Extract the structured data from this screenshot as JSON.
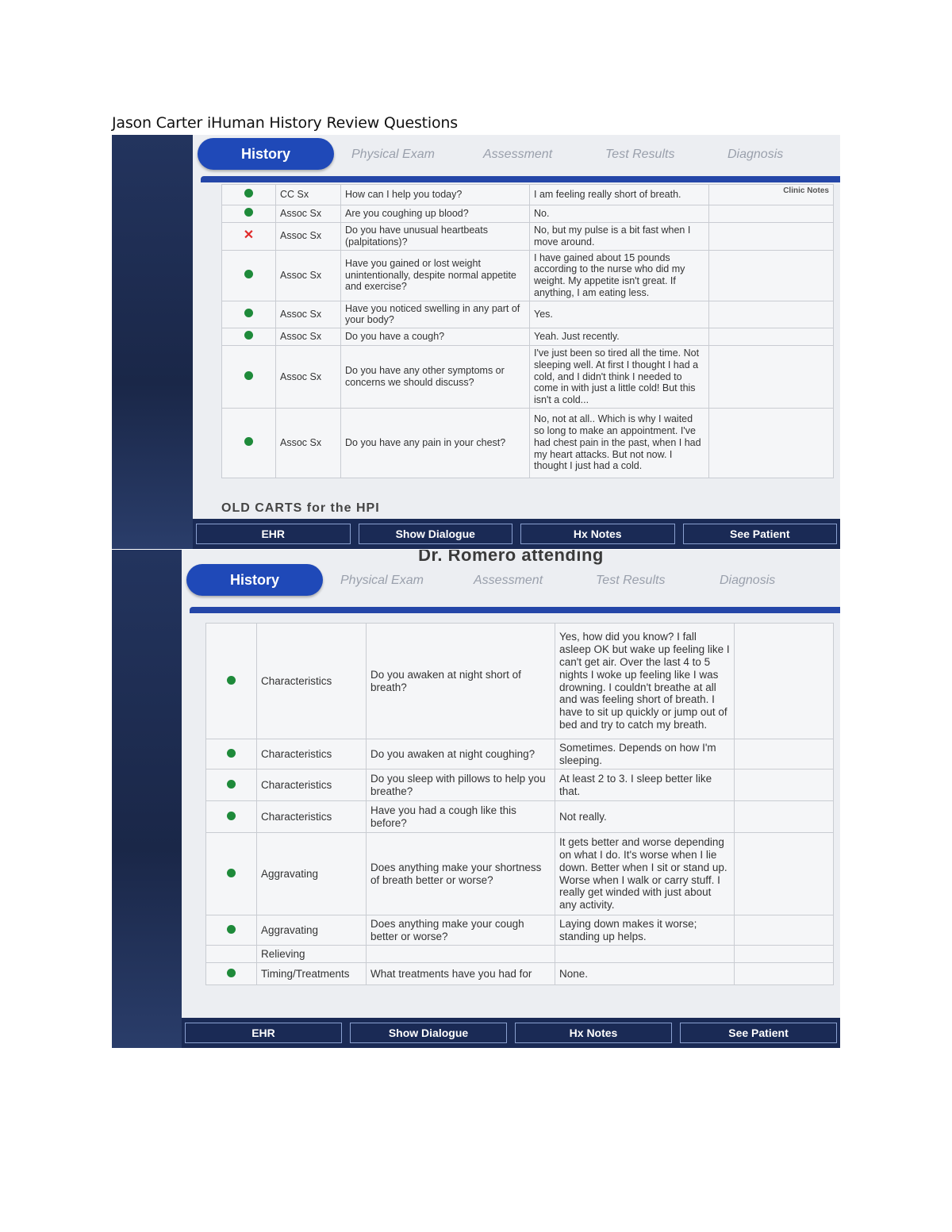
{
  "document_title": "Jason Carter iHuman History Review Questions",
  "top": {
    "tabs": {
      "active": "History",
      "others": [
        "Physical Exam",
        "Assessment",
        "Test Results",
        "Diagnosis"
      ]
    },
    "notes_header": "Clinic Notes",
    "rows": [
      {
        "status": "green",
        "category": "CC Sx",
        "question": "How can I help you today?",
        "answer": "I am feeling really short of breath."
      },
      {
        "status": "green",
        "category": "Assoc Sx",
        "question": "Are you coughing up blood?",
        "answer": "No."
      },
      {
        "status": "red-x",
        "category": "Assoc Sx",
        "question": "Do you have unusual heartbeats (palpitations)?",
        "answer": "No, but my pulse is a bit fast when I move around."
      },
      {
        "status": "green",
        "category": "Assoc Sx",
        "question": "Have you gained or lost weight unintentionally, despite normal appetite and exercise?",
        "answer": "I have gained about 15 pounds according to the nurse who did my weight. My appetite isn't great. If anything, I am eating less."
      },
      {
        "status": "green",
        "category": "Assoc Sx",
        "question": "Have you noticed swelling in any part of your body?",
        "answer": "Yes."
      },
      {
        "status": "green",
        "category": "Assoc Sx",
        "question": "Do you have a cough?",
        "answer": "Yeah. Just recently."
      },
      {
        "status": "green",
        "category": "Assoc Sx",
        "question": "Do you have any other symptoms or concerns we should discuss?",
        "answer": "I've just been so tired all the time. Not sleeping well. At first I thought I had a cold, and I didn't think I needed to come in with just a little cold! But this isn't a cold..."
      },
      {
        "status": "green",
        "category": "Assoc Sx",
        "question": "Do you have any pain in your chest?",
        "answer": "No, not at all.. Which is why I waited so long to make an appointment. I've had chest pain in the past, when I had my heart attacks. But not now. I thought I just had a cold."
      }
    ],
    "cutoff_text": "OLD CARTS for the HPI",
    "footer": [
      "EHR",
      "Show Dialogue",
      "Hx Notes",
      "See Patient"
    ]
  },
  "bottom": {
    "top_cut_text": "Dr. Romero attending",
    "tabs": {
      "active": "History",
      "others": [
        "Physical Exam",
        "Assessment",
        "Test Results",
        "Diagnosis"
      ]
    },
    "rows": [
      {
        "status": "green",
        "category": "Characteristics",
        "question": "Do you awaken at night short of breath?",
        "answer": "Yes, how did you know? I fall asleep OK but wake up feeling like I can't get air. Over the last 4 to 5 nights I woke up feeling like I was drowning. I couldn't breathe at all and was feeling short of breath. I have to sit up quickly or jump out of bed and try to catch my breath."
      },
      {
        "status": "green",
        "category": "Characteristics",
        "question": "Do you awaken at night coughing?",
        "answer": "Sometimes. Depends on how I'm sleeping."
      },
      {
        "status": "green",
        "category": "Characteristics",
        "question": "Do you sleep with pillows to help you breathe?",
        "answer": "At least 2 to 3. I sleep better like that."
      },
      {
        "status": "green",
        "category": "Characteristics",
        "question": "Have you had a cough like this before?",
        "answer": "Not really."
      },
      {
        "status": "green",
        "category": "Aggravating",
        "question": "Does anything make your shortness of breath better or worse?",
        "answer": "It gets better and worse depending on what I do. It's worse when I lie down. Better when I sit or stand up. Worse when I walk or carry stuff. I really get winded with just about any activity."
      },
      {
        "status": "green",
        "category": "Aggravating",
        "question": "Does anything make your cough better or worse?",
        "answer": "Laying down makes it worse; standing up helps."
      },
      {
        "status": "none",
        "category": "Relieving",
        "question": "",
        "answer": ""
      },
      {
        "status": "green",
        "category": "Timing/Treatments",
        "question": "What treatments have you had for",
        "answer": "None."
      }
    ],
    "footer": [
      "EHR",
      "Show Dialogue",
      "Hx Notes",
      "See Patient"
    ]
  }
}
